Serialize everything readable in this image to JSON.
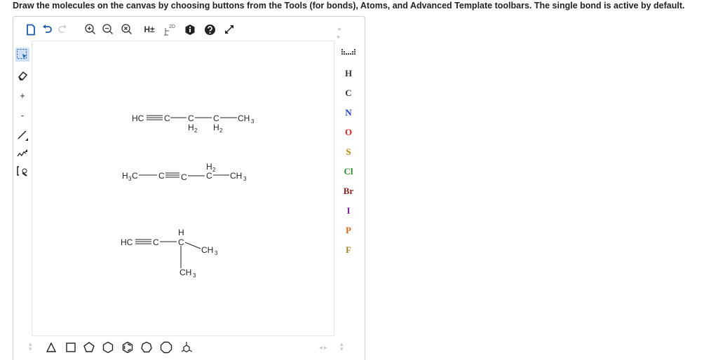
{
  "instruction": "Draw the molecules on the canvas by choosing buttons from the Tools (for bonds), Atoms, and Advanced Template toolbars. The single bond is active by default.",
  "top_toolbar": {
    "icons": [
      "new-document-icon",
      "undo-icon",
      "redo-icon",
      "zoom-in-icon",
      "zoom-out-icon",
      "zoom-reset-icon",
      "add-hydrogens-icon",
      "clean-2d-icon",
      "info-icon",
      "help-icon",
      "fullscreen-icon"
    ],
    "h_label": "H±",
    "clean_label": "2D"
  },
  "left_toolbar": {
    "plus_label": "+",
    "minus_label": "-"
  },
  "atoms": [
    {
      "symbol": "H",
      "color": "#333333"
    },
    {
      "symbol": "C",
      "color": "#333333"
    },
    {
      "symbol": "N",
      "color": "#1f3fbf"
    },
    {
      "symbol": "O",
      "color": "#e02020"
    },
    {
      "symbol": "S",
      "color": "#b8860b"
    },
    {
      "symbol": "Cl",
      "color": "#2e8b2e"
    },
    {
      "symbol": "Br",
      "color": "#8b2020"
    },
    {
      "symbol": "I",
      "color": "#7b1fa2"
    },
    {
      "symbol": "P",
      "color": "#d2691e"
    },
    {
      "symbol": "F",
      "color": "#a0822d"
    }
  ],
  "molecules": {
    "m1": {
      "hc": "HC",
      "c1": "C",
      "c2": "C",
      "h2a": "H",
      "sub_a": "2",
      "c3": "C",
      "h2b": "H",
      "sub_b": "2",
      "ch": "CH",
      "sub_c": "3"
    },
    "m2": {
      "h": "H",
      "sub_a": "3",
      "c": "C",
      "c1": "C",
      "c2": "C",
      "h2": "H",
      "sub_b": "2",
      "c3": "C",
      "ch": "CH",
      "sub_c": "3"
    },
    "m3": {
      "hc": "HC",
      "c1": "C",
      "h": "H",
      "c2": "C",
      "ch": "CH",
      "sub_a": "3",
      "ch_b": "CH",
      "sub_b": "3"
    }
  },
  "templates": [
    "triangle",
    "square",
    "pentagon",
    "hexagon",
    "benzene",
    "heptagon",
    "octagon",
    "custom-template"
  ]
}
